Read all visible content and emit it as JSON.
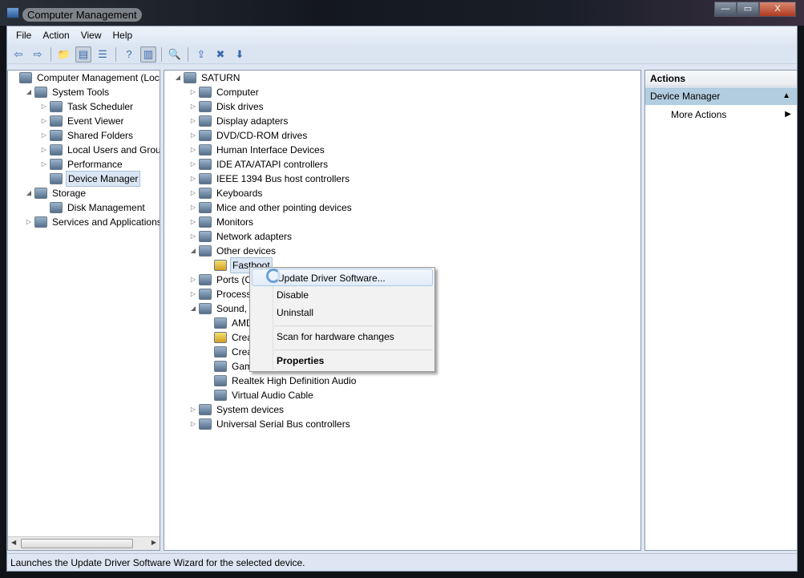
{
  "window": {
    "title": "Computer Management",
    "minimize": "—",
    "maximize": "▭",
    "close": "X"
  },
  "menu": [
    "File",
    "Action",
    "View",
    "Help"
  ],
  "toolbar": [
    {
      "icon": "back-icon",
      "g": "⇦"
    },
    {
      "icon": "forward-icon",
      "g": "⇨"
    },
    {
      "sep": true
    },
    {
      "icon": "up-folder-icon",
      "g": "📁"
    },
    {
      "icon": "show-hide-tree-icon",
      "g": "▤",
      "pressed": true
    },
    {
      "icon": "export-list-icon",
      "g": "☰"
    },
    {
      "sep": true
    },
    {
      "icon": "help-icon",
      "g": "?"
    },
    {
      "icon": "show-hide-action-pane-icon",
      "g": "▥",
      "pressed": true
    },
    {
      "sep": true
    },
    {
      "icon": "scan-hardware-icon",
      "g": "🔍"
    },
    {
      "sep": true
    },
    {
      "icon": "update-driver-icon",
      "g": "⇪"
    },
    {
      "icon": "uninstall-icon",
      "g": "✖"
    },
    {
      "icon": "disable-icon",
      "g": "⬇"
    }
  ],
  "left_tree": [
    {
      "label": "Computer Management (Local",
      "level": 0,
      "exp": ""
    },
    {
      "label": "System Tools",
      "level": 1,
      "exp": "◢"
    },
    {
      "label": "Task Scheduler",
      "level": 2,
      "exp": "▷"
    },
    {
      "label": "Event Viewer",
      "level": 2,
      "exp": "▷"
    },
    {
      "label": "Shared Folders",
      "level": 2,
      "exp": "▷"
    },
    {
      "label": "Local Users and Groups",
      "level": 2,
      "exp": "▷"
    },
    {
      "label": "Performance",
      "level": 2,
      "exp": "▷"
    },
    {
      "label": "Device Manager",
      "level": 2,
      "exp": "",
      "selected": true
    },
    {
      "label": "Storage",
      "level": 1,
      "exp": "◢"
    },
    {
      "label": "Disk Management",
      "level": 2,
      "exp": ""
    },
    {
      "label": "Services and Applications",
      "level": 1,
      "exp": "▷"
    }
  ],
  "device_tree": [
    {
      "label": "SATURN",
      "level": 0,
      "exp": "◢"
    },
    {
      "label": "Computer",
      "level": 1,
      "exp": "▷"
    },
    {
      "label": "Disk drives",
      "level": 1,
      "exp": "▷"
    },
    {
      "label": "Display adapters",
      "level": 1,
      "exp": "▷"
    },
    {
      "label": "DVD/CD-ROM drives",
      "level": 1,
      "exp": "▷"
    },
    {
      "label": "Human Interface Devices",
      "level": 1,
      "exp": "▷"
    },
    {
      "label": "IDE ATA/ATAPI controllers",
      "level": 1,
      "exp": "▷"
    },
    {
      "label": "IEEE 1394 Bus host controllers",
      "level": 1,
      "exp": "▷"
    },
    {
      "label": "Keyboards",
      "level": 1,
      "exp": "▷"
    },
    {
      "label": "Mice and other pointing devices",
      "level": 1,
      "exp": "▷"
    },
    {
      "label": "Monitors",
      "level": 1,
      "exp": "▷"
    },
    {
      "label": "Network adapters",
      "level": 1,
      "exp": "▷"
    },
    {
      "label": "Other devices",
      "level": 1,
      "exp": "◢"
    },
    {
      "label": "Fastboot",
      "level": 2,
      "exp": "",
      "selected": true,
      "warning": true
    },
    {
      "label": "Ports (CO",
      "level": 1,
      "exp": "▷"
    },
    {
      "label": "Processo",
      "level": 1,
      "exp": "▷"
    },
    {
      "label": "Sound, v",
      "level": 1,
      "exp": "◢"
    },
    {
      "label": "AMD",
      "level": 2,
      "exp": ""
    },
    {
      "label": "Creat",
      "level": 2,
      "exp": "",
      "warning": true
    },
    {
      "label": "Creat",
      "level": 2,
      "exp": ""
    },
    {
      "label": "Gam",
      "level": 2,
      "exp": ""
    },
    {
      "label": "Realtek High Definition Audio",
      "level": 2,
      "exp": ""
    },
    {
      "label": "Virtual Audio Cable",
      "level": 2,
      "exp": ""
    },
    {
      "label": "System devices",
      "level": 1,
      "exp": "▷"
    },
    {
      "label": "Universal Serial Bus controllers",
      "level": 1,
      "exp": "▷"
    }
  ],
  "context_menu": {
    "update": "Update Driver Software...",
    "disable": "Disable",
    "uninstall": "Uninstall",
    "scan": "Scan for hardware changes",
    "properties": "Properties"
  },
  "actions": {
    "header": "Actions",
    "section": "Device Manager",
    "more": "More Actions"
  },
  "status": "Launches the Update Driver Software Wizard for the selected device."
}
